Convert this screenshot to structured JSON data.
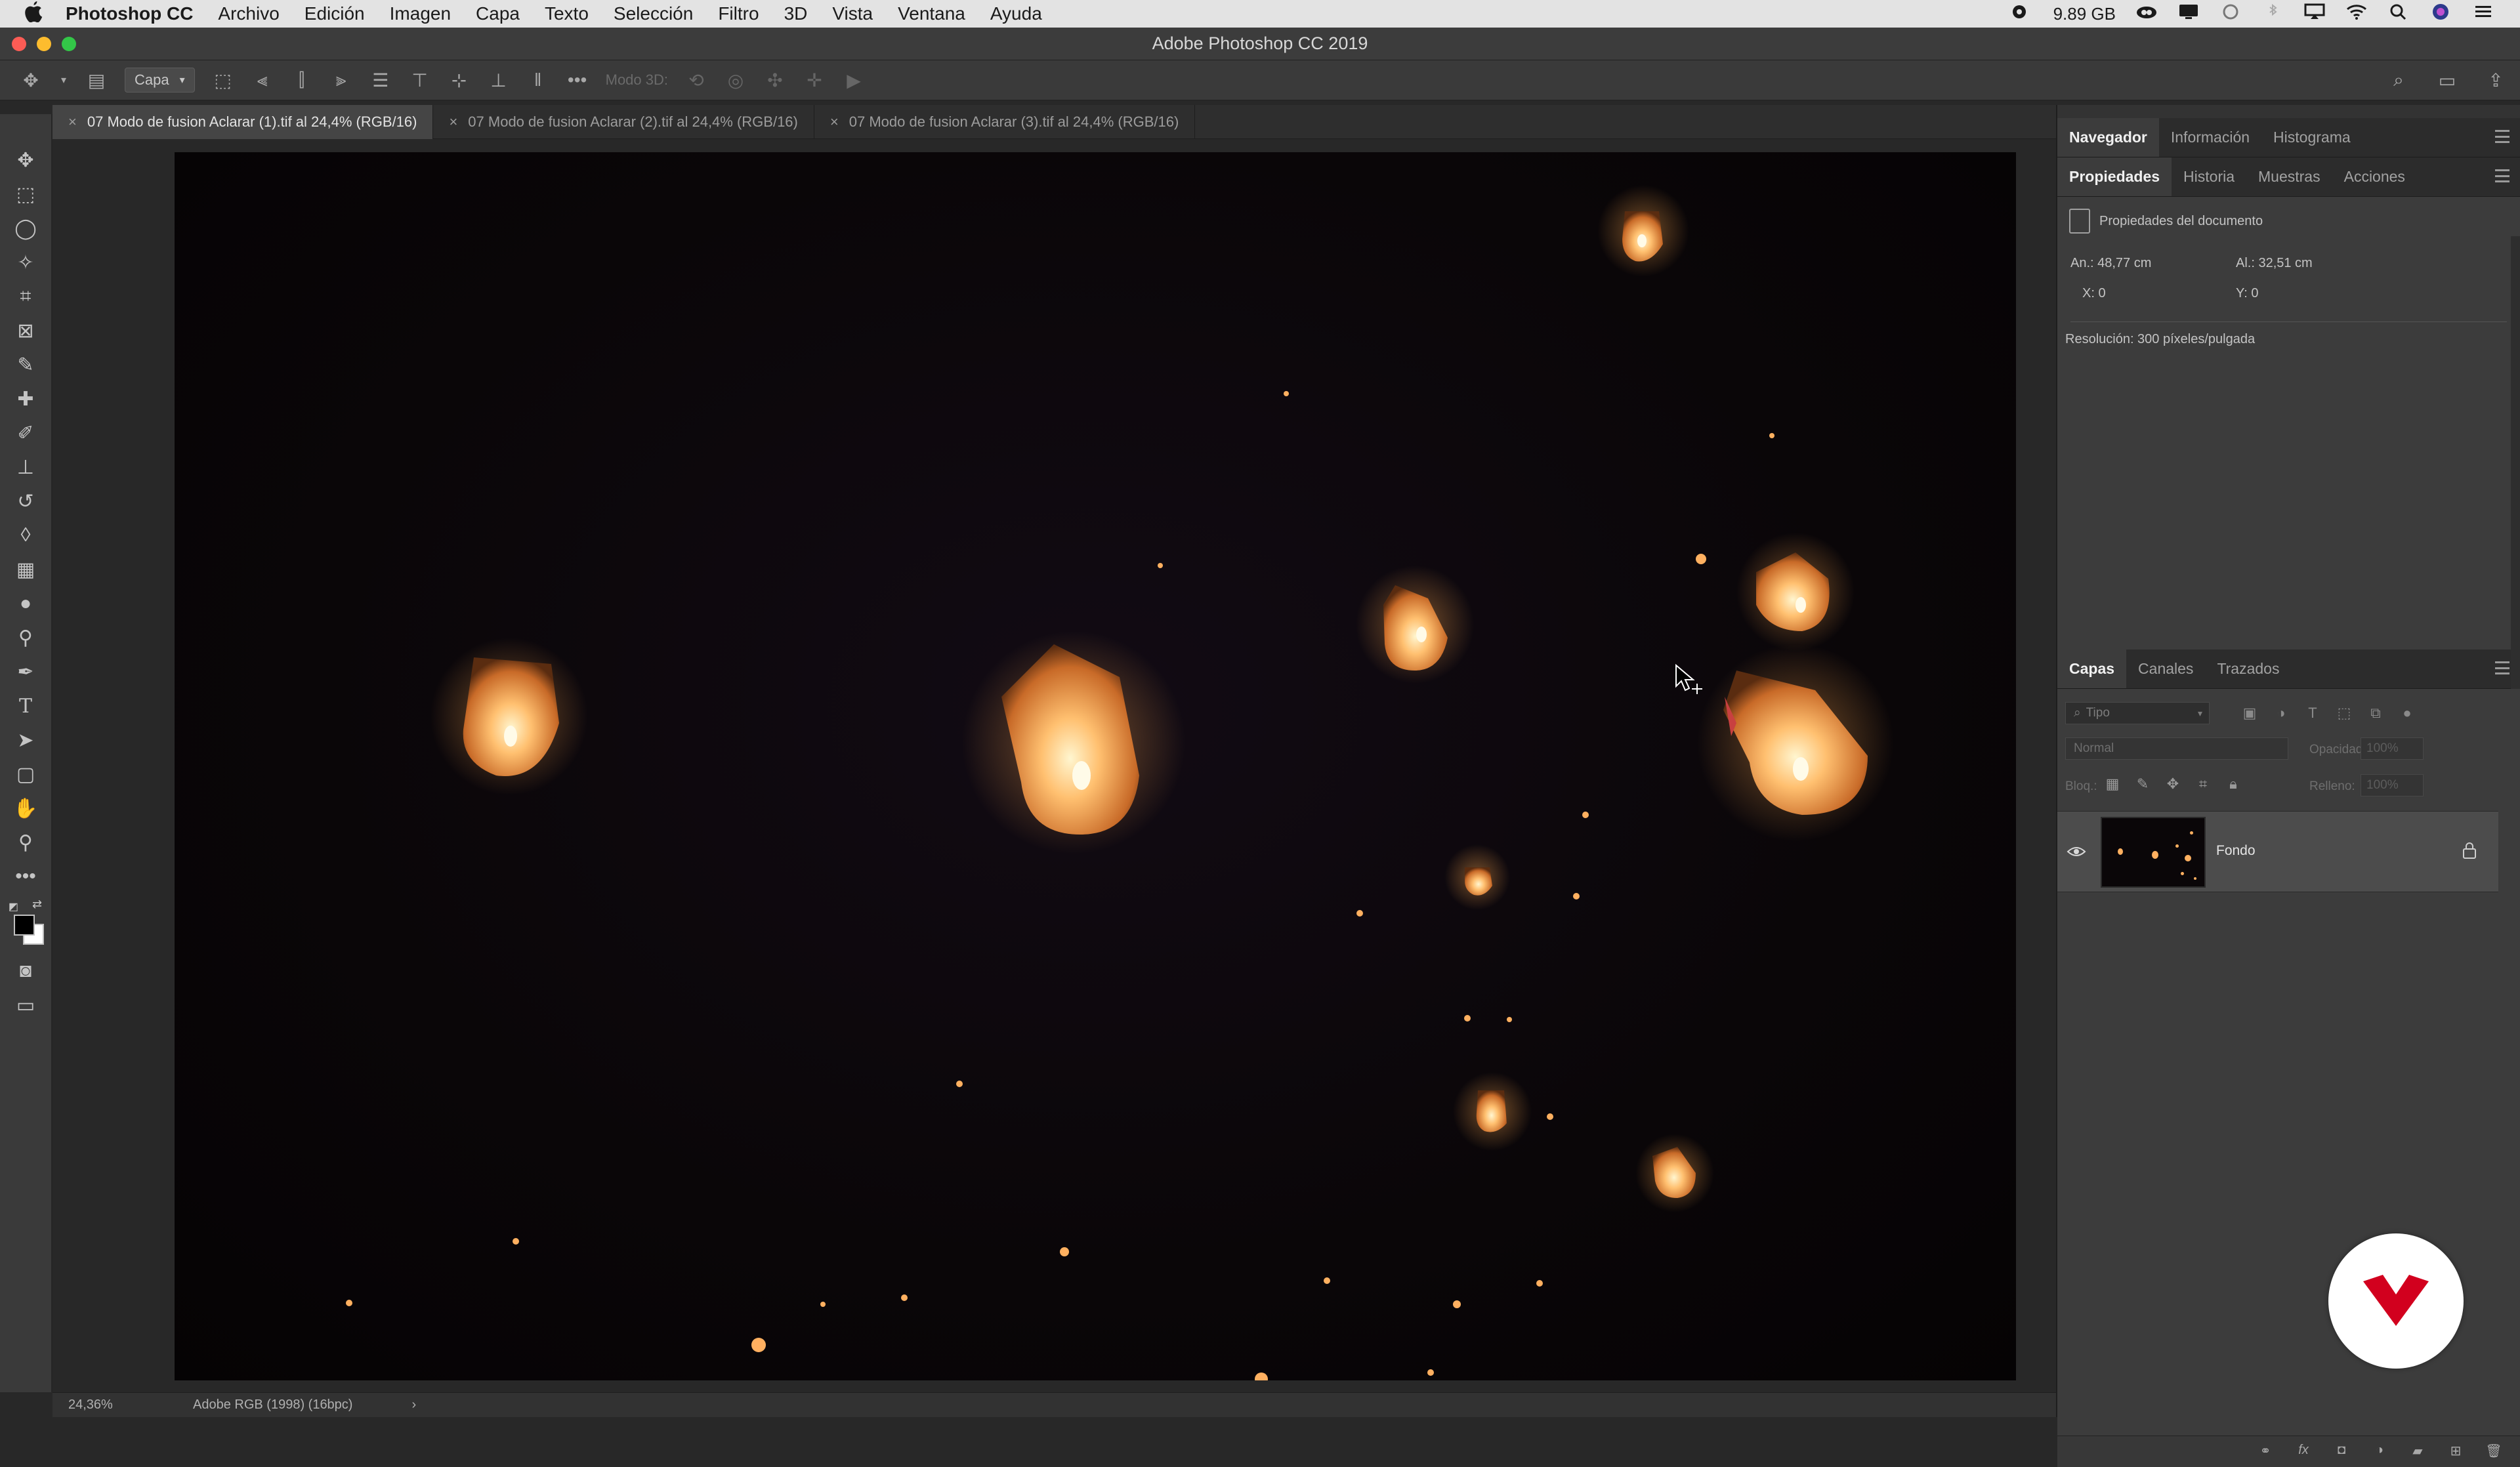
{
  "menubar": {
    "app_name": "Photoshop CC",
    "menus": [
      "Archivo",
      "Edición",
      "Imagen",
      "Capa",
      "Texto",
      "Selección",
      "Filtro",
      "3D",
      "Vista",
      "Ventana",
      "Ayuda"
    ],
    "storage": "9.89 GB"
  },
  "window": {
    "title": "Adobe Photoshop CC 2019"
  },
  "options_bar": {
    "auto_select_target": "Capa",
    "mode_3d_label": "Modo 3D:"
  },
  "documents": {
    "tabs": [
      {
        "label": "07 Modo de fusion Aclarar (1).tif al 24,4% (RGB/16)",
        "active": true
      },
      {
        "label": "07 Modo de fusion Aclarar (2).tif al 24,4% (RGB/16)",
        "active": false
      },
      {
        "label": "07 Modo de fusion Aclarar (3).tif al 24,4% (RGB/16)",
        "active": false
      }
    ]
  },
  "status_bar": {
    "zoom": "24,36%",
    "color_profile": "Adobe RGB (1998) (16bpc)"
  },
  "panels": {
    "top_group_tabs": [
      "Navegador",
      "Información",
      "Histograma"
    ],
    "props_group_tabs": [
      "Propiedades",
      "Historia",
      "Muestras",
      "Acciones"
    ],
    "properties": {
      "title": "Propiedades del documento",
      "width": "An.: 48,77 cm",
      "height": "Al.: 32,51 cm",
      "x": "X: 0",
      "y": "Y: 0",
      "resolution": "Resolución: 300 píxeles/pulgada"
    },
    "layers_group_tabs": [
      "Capas",
      "Canales",
      "Trazados"
    ],
    "layers": {
      "filter_placeholder": "Tipo",
      "blend_mode": "Normal",
      "opacity_label": "Opacidad:",
      "opacity_value": "100%",
      "lock_label": "Bloq.:",
      "fill_label": "Relleno:",
      "fill_value": "100%",
      "items": [
        {
          "name": "Fondo",
          "visible": true,
          "locked": true
        }
      ]
    }
  },
  "colors": {
    "accent_red": "#d2001e",
    "ui_dark": "#333333",
    "lantern_glow": "#ffb060"
  }
}
